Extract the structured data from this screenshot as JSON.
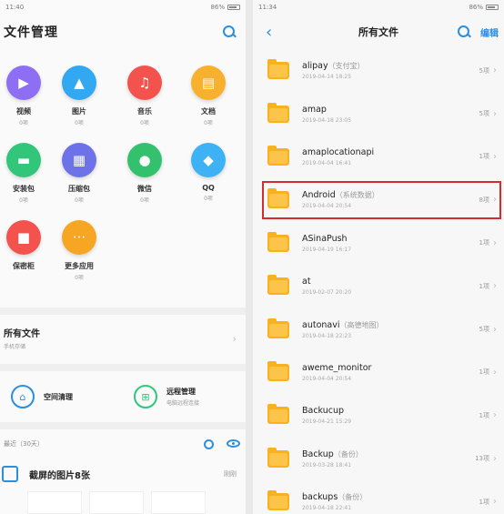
{
  "left": {
    "status": {
      "left": "11:40",
      "right": "86%"
    },
    "title": "文件管理",
    "categories": [
      {
        "label": "视频",
        "count": "0项",
        "color": "#8e6ef2",
        "icon": "▶"
      },
      {
        "label": "图片",
        "count": "0项",
        "color": "#31a8ef",
        "icon": "▲"
      },
      {
        "label": "音乐",
        "count": "0项",
        "color": "#f3524d",
        "icon": "♫"
      },
      {
        "label": "文档",
        "count": "0项",
        "color": "#f7b12c",
        "icon": "▤"
      },
      {
        "label": "安装包",
        "count": "0项",
        "color": "#32c67b",
        "icon": "▬"
      },
      {
        "label": "压缩包",
        "count": "0项",
        "color": "#6d72e8",
        "icon": "▦"
      },
      {
        "label": "微信",
        "count": "0项",
        "color": "#34c16e",
        "icon": "●"
      },
      {
        "label": "QQ",
        "count": "0项",
        "color": "#3eb2f5",
        "icon": "◆"
      },
      {
        "label": "保密柜",
        "count": "",
        "color": "#f3524d",
        "icon": "■"
      },
      {
        "label": "更多应用",
        "count": "0项",
        "color": "#f7a623",
        "icon": "···"
      }
    ],
    "all_files": {
      "title": "所有文件",
      "subtitle": "手机存储"
    },
    "tools": [
      {
        "title": "空间清理",
        "subtitle": "",
        "color": "#2b8fe0",
        "icon": "⌂"
      },
      {
        "title": "远程管理",
        "subtitle": "电脑远程连接",
        "color": "#32c67b",
        "icon": "⊞"
      }
    ],
    "recent_label": "最近（30天）",
    "screenshot_row": {
      "title": "截屏的图片8张",
      "time": "刚刚"
    }
  },
  "right": {
    "status": {
      "left": "11:34",
      "right": "86%"
    },
    "title": "所有文件",
    "edit_label": "编辑",
    "folders": [
      {
        "name": "alipay",
        "tag": "（支付宝）",
        "date": "2019-04-14 18:25",
        "count": "5项"
      },
      {
        "name": "amap",
        "tag": "",
        "date": "2019-04-18 23:05",
        "count": "5项"
      },
      {
        "name": "amaplocationapi",
        "tag": "",
        "date": "2019-04-04 16:41",
        "count": "1项"
      },
      {
        "name": "Android",
        "tag": "（系统数据）",
        "date": "2019-04-04 20:54",
        "count": "8项",
        "highlight": true
      },
      {
        "name": "ASinaPush",
        "tag": "",
        "date": "2019-04-19 16:17",
        "count": "1项"
      },
      {
        "name": "at",
        "tag": "",
        "date": "2019-02-07 20:20",
        "count": "1项"
      },
      {
        "name": "autonavi",
        "tag": "（高德地图）",
        "date": "2019-04-18 22:23",
        "count": "5项"
      },
      {
        "name": "aweme_monitor",
        "tag": "",
        "date": "2019-04-04 20:54",
        "count": "1项"
      },
      {
        "name": "Backucup",
        "tag": "",
        "date": "2019-04-21 15:29",
        "count": "1项"
      },
      {
        "name": "Backup",
        "tag": "（备份）",
        "date": "2019-03-28 18:41",
        "count": "13项"
      },
      {
        "name": "backups",
        "tag": "（备份）",
        "date": "2019-04-18 22:41",
        "count": "1项"
      }
    ]
  }
}
